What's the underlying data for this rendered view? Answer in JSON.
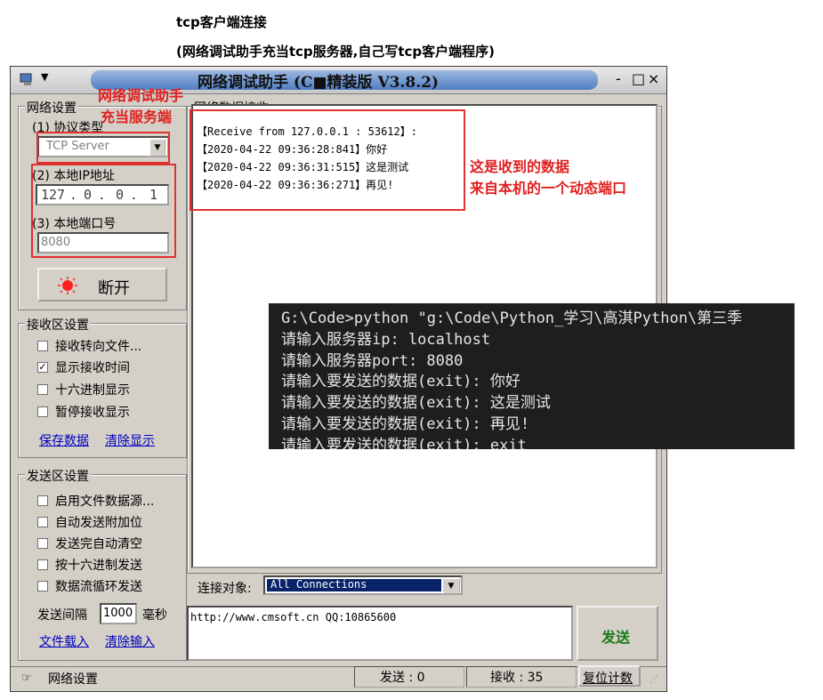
{
  "headings": {
    "line1": "tcp客户端连接",
    "line2": "(网络调试助手充当tcp服务器,自己写tcp客户端程序)"
  },
  "window": {
    "title": "网络调试助手 (C■精装版 V3.8.2)",
    "controls": [
      "-",
      "□",
      "×"
    ]
  },
  "network_settings": {
    "group_label": "网络设置",
    "protocol_label": "(1) 协议类型",
    "protocol_value": "TCP Server",
    "ip_label": "(2) 本地IP地址",
    "ip_parts": [
      "127",
      "0",
      "0",
      "1"
    ],
    "port_label": "(3) 本地端口号",
    "port_value": "8080",
    "connect_button": "断开"
  },
  "receive_settings": {
    "group_label": "接收区设置",
    "options": [
      {
        "label": "接收转向文件...",
        "checked": false
      },
      {
        "label": "显示接收时间",
        "checked": true
      },
      {
        "label": "十六进制显示",
        "checked": false
      },
      {
        "label": "暂停接收显示",
        "checked": false
      }
    ],
    "save_link": "保存数据",
    "clear_link": "清除显示"
  },
  "send_settings": {
    "group_label": "发送区设置",
    "options": [
      {
        "label": "启用文件数据源...",
        "checked": false
      },
      {
        "label": "自动发送附加位",
        "checked": false
      },
      {
        "label": "发送完自动清空",
        "checked": false
      },
      {
        "label": "按十六进制发送",
        "checked": false
      },
      {
        "label": "数据流循环发送",
        "checked": false
      }
    ],
    "interval_label": "发送间隔",
    "interval_value": "1000",
    "interval_unit": "毫秒",
    "load_link": "文件载入",
    "clear_link": "清除输入"
  },
  "receive_area": {
    "label": "网络数据接收",
    "lines": [
      "【Receive from 127.0.0.1 : 53612】:",
      "【2020-04-22 09:36:28:841】你好",
      "【2020-04-22 09:36:31:515】这是测试",
      "【2020-04-22 09:36:36:271】再见!"
    ]
  },
  "connection": {
    "label": "连接对象:",
    "value": "All Connections"
  },
  "send_area": {
    "text": "http://www.cmsoft.cn QQ:10865600",
    "send_button": "发送"
  },
  "status_bar": {
    "left": "网络设置",
    "send_count": "发送 : 0",
    "recv_count": "接收 : 35",
    "reset_button": "复位计数"
  },
  "annotations": {
    "server_note_1": "网络调试助手",
    "server_note_2": "充当服务端",
    "recv_note_1": "这是收到的数据",
    "recv_note_2": "来自本机的一个动态端口"
  },
  "console": {
    "lines": [
      "G:\\Code>python \"g:\\Code\\Python_学习\\高淇Python\\第三季",
      "请输入服务器ip: localhost",
      "请输入服务器port: 8080",
      "请输入要发送的数据(exit): 你好",
      "请输入要发送的数据(exit): 这是测试",
      "请输入要发送的数据(exit): 再见!",
      "请输入要发送的数据(exit): exit"
    ]
  },
  "colors": {
    "annotation_red": "#e02020",
    "window_gray": "#d4d0c8",
    "send_green": "#1a7a1a",
    "console_bg": "#1e1e1e"
  }
}
